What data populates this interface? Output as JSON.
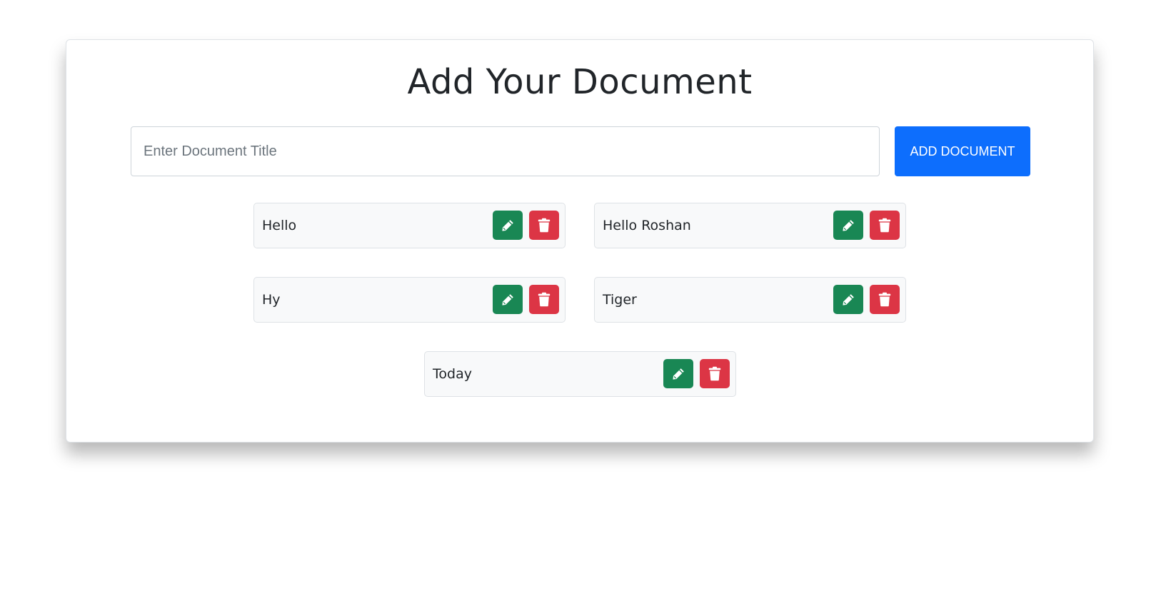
{
  "page": {
    "title": "Add Your Document"
  },
  "form": {
    "input_value": "",
    "input_placeholder": "Enter Document Title",
    "add_button_label": "ADD DOCUMENT"
  },
  "documents": [
    {
      "title": "Hello"
    },
    {
      "title": "Hello Roshan"
    },
    {
      "title": "Hy"
    },
    {
      "title": "Tiger"
    },
    {
      "title": "Today"
    }
  ],
  "icons": {
    "edit": "pencil-icon",
    "delete": "trash-icon"
  },
  "colors": {
    "primary": "#0d6efd",
    "edit": "#198754",
    "delete": "#dc3545",
    "item_background": "#f8f9fa"
  }
}
